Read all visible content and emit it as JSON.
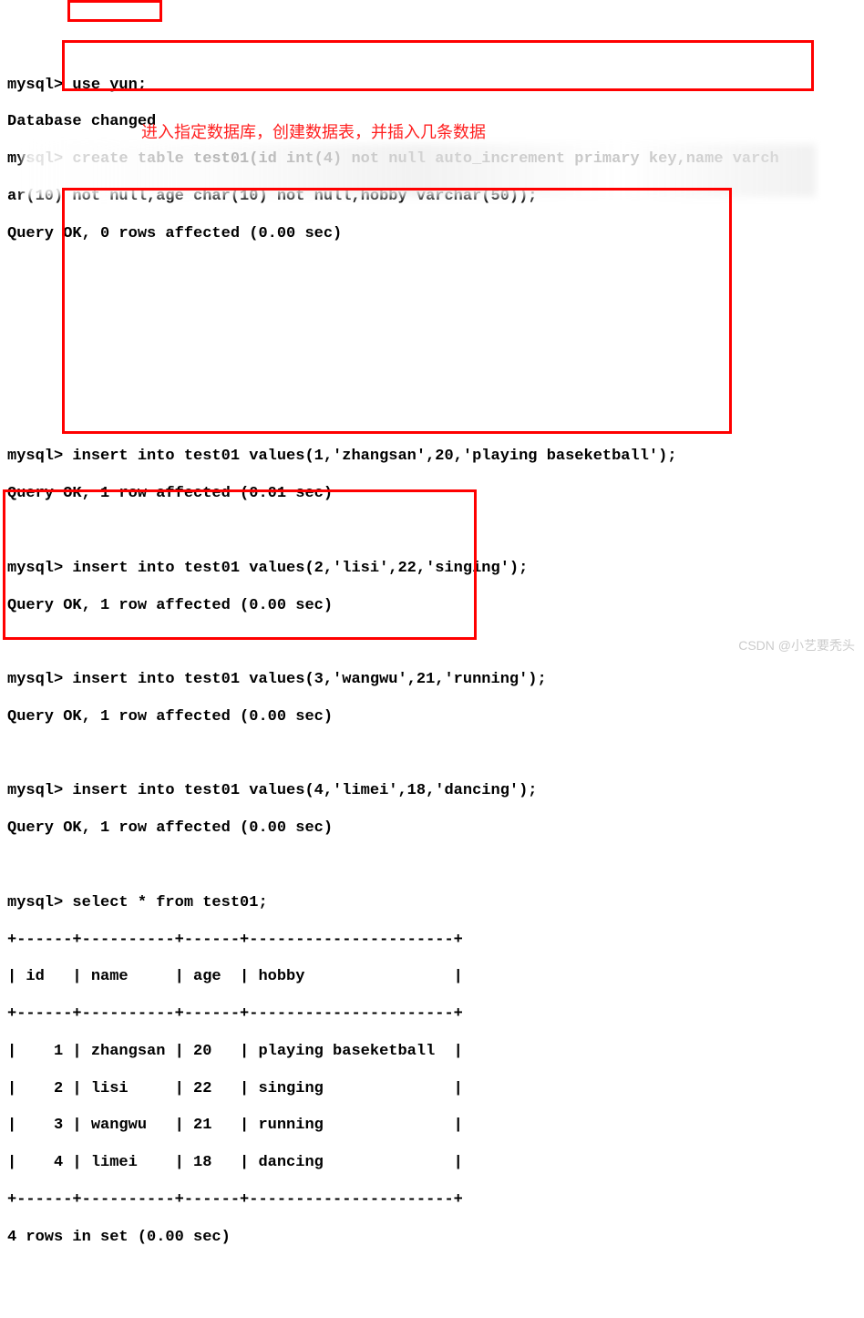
{
  "lines": {
    "l01": "mysql> use yun;",
    "l02": "Database changed",
    "l03": "mysql> create table test01(id int(4) not null auto_increment primary key,name varch",
    "l04": "ar(10) not null,age char(10) not null,hobby varchar(50));",
    "l05": "Query OK, 0 rows affected (0.00 sec)",
    "l06a": " ",
    "l06b": " ",
    "l06c": " ",
    "l06d": " ",
    "l07": " ",
    "l08": "mysql> insert into test01 values(1,'zhangsan',20,'playing baseketball');",
    "l09": "Query OK, 1 row affected (0.01 sec)",
    "l10": " ",
    "l11": "mysql> insert into test01 values(2,'lisi',22,'singing');",
    "l12": "Query OK, 1 row affected (0.00 sec)",
    "l13": " ",
    "l14": "mysql> insert into test01 values(3,'wangwu',21,'running');",
    "l15": "Query OK, 1 row affected (0.00 sec)",
    "l16": " ",
    "l17": "mysql> insert into test01 values(4,'limei',18,'dancing');",
    "l18": "Query OK, 1 row affected (0.00 sec)",
    "l19": " ",
    "l20": "mysql> select * from test01;",
    "t_border_top": "+------+----------+------+----------------------+",
    "t_header": "| id   | name     | age  | hobby                |",
    "t_border_mid": "+------+----------+------+----------------------+",
    "t_row1": "|    1 | zhangsan | 20   | playing baseketball  |",
    "t_row2": "|    2 | lisi     | 22   | singing              |",
    "t_row3": "|    3 | wangwu   | 21   | running              |",
    "t_row4": "|    4 | limei    | 18   | dancing              |",
    "t_border_bot": "+------+----------+------+----------------------+",
    "l_footer": "4 rows in set (0.00 sec)"
  },
  "annotation": "进入指定数据库，创建数据表，并插入几条数据",
  "watermark": "CSDN @小艺要秃头"
}
